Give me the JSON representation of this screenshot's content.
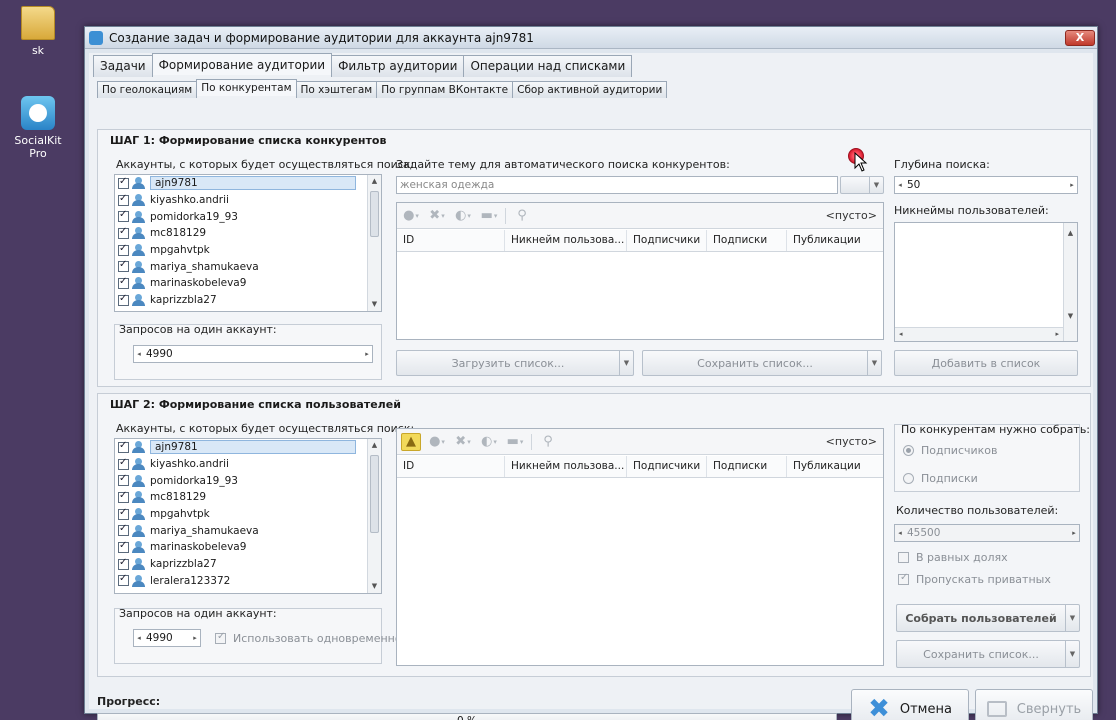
{
  "desktop": {
    "icons": [
      {
        "label": "sk"
      },
      {
        "label": "SocialKit Pro"
      }
    ]
  },
  "window": {
    "title": "Создание задач и формирование аудитории для аккаунта ajn9781",
    "close_label": "X"
  },
  "tabs_main": [
    "Задачи",
    "Формирование аудитории",
    "Фильтр аудитории",
    "Операции над списками"
  ],
  "tabs_sub": [
    "По геолокациям",
    "По конкурентам",
    "По хэштегам",
    "По группам ВКонтакте",
    "Сбор активной аудитории"
  ],
  "step1": {
    "title": "ШАГ 1: Формирование списка конкурентов",
    "accounts_label": "Аккаунты, с которых будет осуществляться поиск:",
    "accounts": [
      "ajn9781",
      "kiyashko.andrii",
      "pomidorka19_93",
      "mc818129",
      "mpgahvtpk",
      "mariya_shamukaeva",
      "marinaskobeleva9",
      "kaprizzbla27"
    ],
    "requests_label": "Запросов на один аккаунт:",
    "requests_value": "4990",
    "topic_label": "Задайте тему для автоматического поиска конкурентов:",
    "topic_placeholder": "женская одежда",
    "empty_label": "<пусто>",
    "columns": [
      "ID",
      "Никнейм пользова...",
      "Подписчики",
      "Подписки",
      "Публикации"
    ],
    "load_button": "Загрузить список...",
    "save_button": "Сохранить список...",
    "depth_label": "Глубина поиска:",
    "depth_value": "50",
    "nicknames_label": "Никнеймы пользователей:",
    "add_button": "Добавить в список"
  },
  "step2": {
    "title": "ШАГ 2: Формирование списка пользователей",
    "accounts_label": "Аккаунты, с которых будет осуществляться поиск:",
    "accounts": [
      "ajn9781",
      "kiyashko.andrii",
      "pomidorka19_93",
      "mc818129",
      "mpgahvtpk",
      "mariya_shamukaeva",
      "marinaskobeleva9",
      "kaprizzbla27",
      "leralera123372"
    ],
    "requests_label": "Запросов на один аккаунт:",
    "requests_value": "4990",
    "use_simultaneously": "Использовать одновременно",
    "empty_label": "<пусто>",
    "columns": [
      "ID",
      "Никнейм пользова...",
      "Подписчики",
      "Подписки",
      "Публикации"
    ],
    "collect_label": "По конкурентам нужно собрать:",
    "radio_followers": "Подписчиков",
    "radio_following": "Подписки",
    "count_label": "Количество пользователей:",
    "count_value": "45500",
    "equal_shares": "В равных долях",
    "skip_private": "Пропускать приватных",
    "collect_button": "Собрать пользователей",
    "save_button": "Сохранить список..."
  },
  "footer": {
    "progress_label": "Прогресс:",
    "progress_text": "0 %",
    "progress_value": 0,
    "cancel_button": "Отмена",
    "minimize_button": "Свернуть"
  }
}
